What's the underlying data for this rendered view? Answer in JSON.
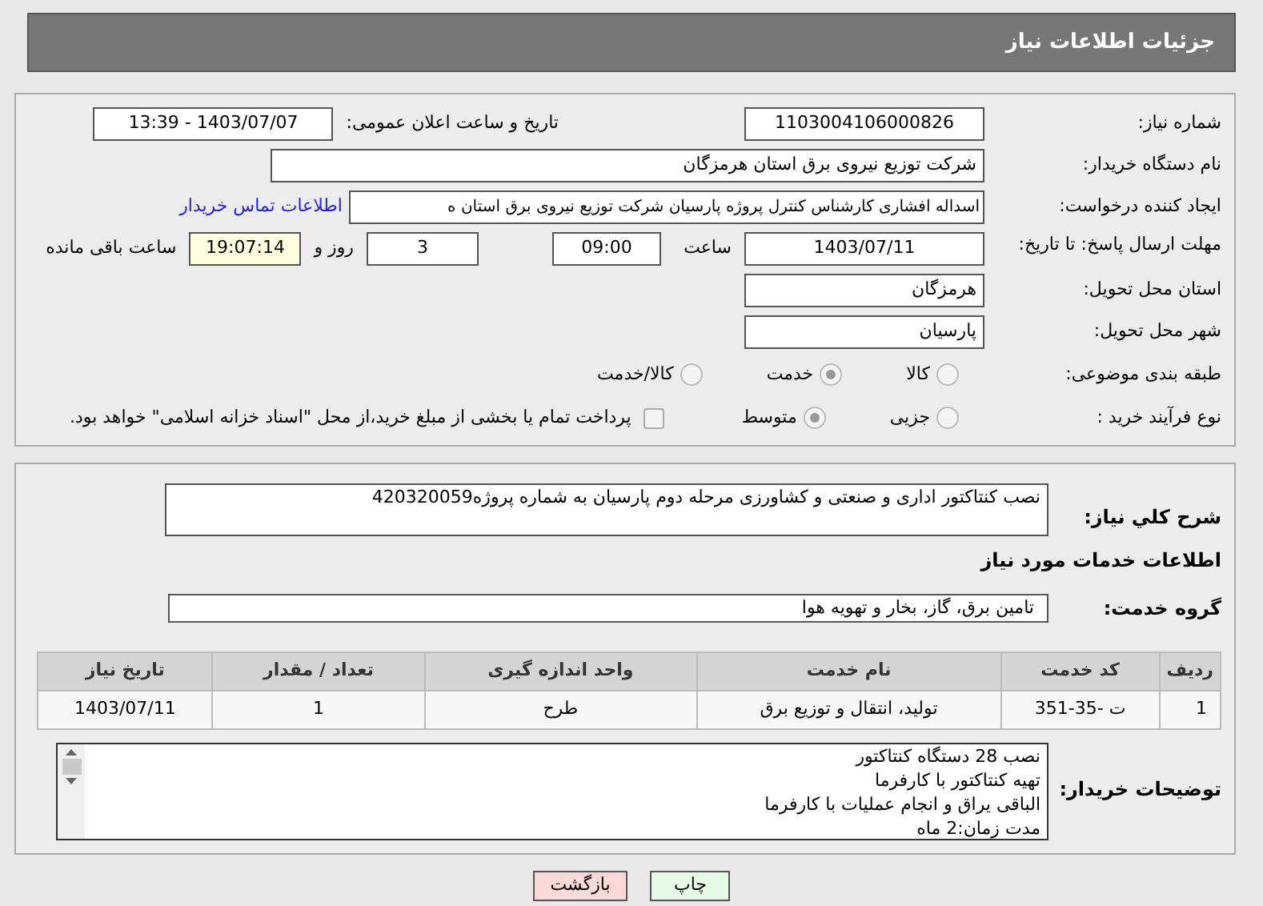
{
  "header": {
    "title": "جزئیات اطلاعات نیاز"
  },
  "details": {
    "need_number": {
      "label": "شماره نیاز:",
      "value": "1103004106000826"
    },
    "announce_date": {
      "label": "تاریخ و ساعت اعلان عمومی:",
      "value": "1403/07/07 - 13:39"
    },
    "buyer_org": {
      "label": "نام دستگاه خریدار:",
      "value": "شرکت توزیع نیروی برق استان هرمزگان"
    },
    "requester": {
      "label": "ایجاد کننده درخواست:",
      "value": "اسداله افشاری کارشناس کنترل پروژه پارسیان شرکت توزیع نیروی برق استان ه",
      "link": "اطلاعات تماس خریدار"
    },
    "deadline": {
      "label": "مهلت ارسال پاسخ: تا تاریخ:",
      "date": "1403/07/11",
      "time_label": "ساعت",
      "time": "09:00",
      "days": "3",
      "days_label": "روز و",
      "remaining": "19:07:14",
      "remaining_label": "ساعت باقی مانده"
    },
    "province": {
      "label": "استان محل تحویل:",
      "value": "هرمزگان"
    },
    "city": {
      "label": "شهر محل تحویل:",
      "value": "پارسیان"
    },
    "category": {
      "label": "طبقه بندی موضوعی:",
      "options": [
        {
          "label": "کالا",
          "selected": false
        },
        {
          "label": "خدمت",
          "selected": true
        },
        {
          "label": "کالا/خدمت",
          "selected": false
        }
      ]
    },
    "process": {
      "label": "نوع فرآیند خرید :",
      "options": [
        {
          "label": "جزیی",
          "selected": false
        },
        {
          "label": "متوسط",
          "selected": true
        }
      ],
      "payment": {
        "label": "پرداخت تمام یا بخشی از مبلغ خرید،از محل \"اسناد خزانه اسلامی\" خواهد بود.",
        "checked": false
      }
    }
  },
  "services": {
    "summary_label": "شرح کلي نياز:",
    "summary": "نصب کنتاکتور اداری و صنعتی و کشاورزی مرحله دوم پارسیان به شماره پروژه420320059",
    "section_title": "اطلاعات خدمات مورد نیاز",
    "group_label": "گروه خدمت:",
    "group": "تامین برق، گاز، بخار و تهویه هوا",
    "table": {
      "columns": [
        "ردیف",
        "کد خدمت",
        "نام خدمت",
        "واحد اندازه گیری",
        "تعداد / مقدار",
        "تاریخ نیاز"
      ],
      "rows": [
        [
          "1",
          "ت -35-351",
          "تولید، انتقال و توزیع برق",
          "طرح",
          "1",
          "1403/07/11"
        ]
      ]
    },
    "notes_label": "توضیحات خریدار:",
    "notes": [
      "نصب 28 دستگاه کنتاکتور",
      "تهیه کنتاکتور با کارفرما",
      "الباقی یراق و انجام عملیات با کارفرما",
      "مدت زمان:2 ماه"
    ]
  },
  "buttons": [
    {
      "label": "چاپ",
      "kind": "print"
    },
    {
      "label": "بازگشت",
      "kind": "back"
    }
  ]
}
